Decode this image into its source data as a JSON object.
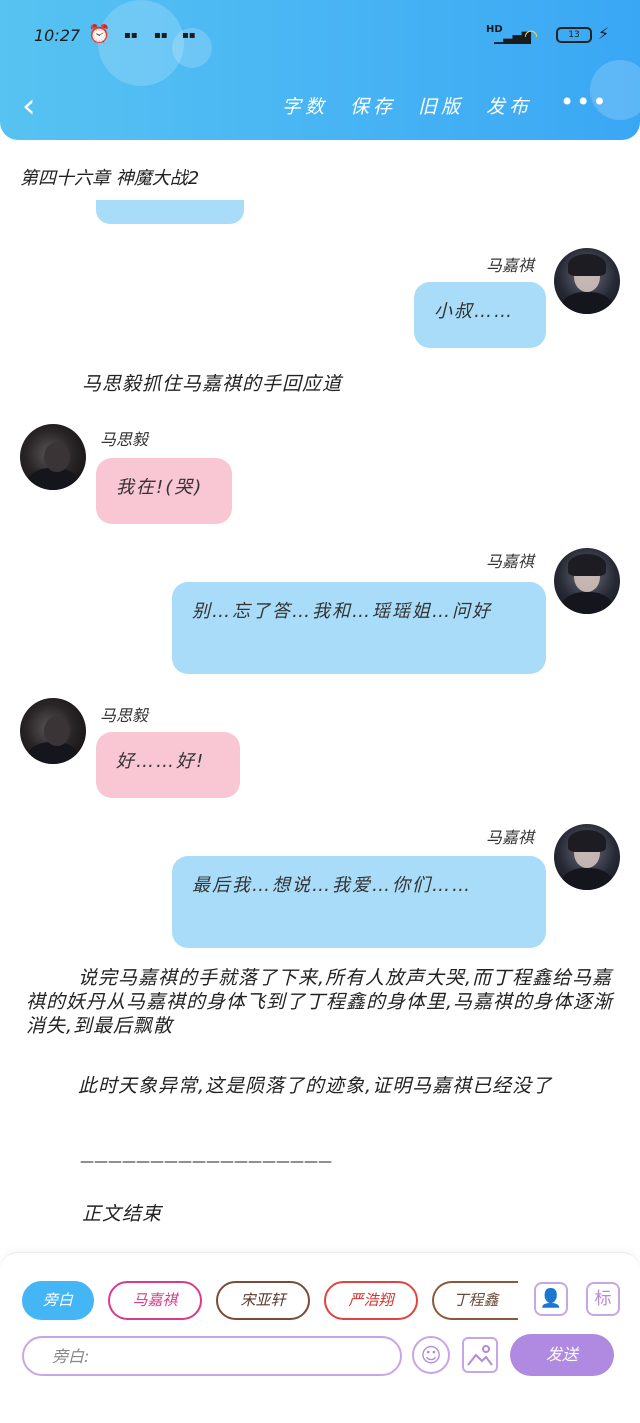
{
  "status_bar": {
    "time": "10:27",
    "network": "HD",
    "battery": "13"
  },
  "header": {
    "actions": [
      "字数",
      "保存",
      "旧版",
      "发布"
    ],
    "more": "•••"
  },
  "chapter_title": "第四十六章 神魔大战2",
  "messages": [
    {
      "side": "right",
      "name": "马嘉祺",
      "text": "小叔……"
    },
    {
      "side": "narration",
      "text": "马思毅抓住马嘉祺的手回应道"
    },
    {
      "side": "left",
      "name": "马思毅",
      "text": "我在!(哭)"
    },
    {
      "side": "right",
      "name": "马嘉祺",
      "text": "别…忘了答…我和…瑶瑶姐…问好"
    },
    {
      "side": "left",
      "name": "马思毅",
      "text": "好……好!"
    },
    {
      "side": "right",
      "name": "马嘉祺",
      "text": "最后我…想说…我爱…你们……"
    }
  ],
  "narration": {
    "p1": "说完马嘉祺的手就落了下来,所有人放声大哭,而丁程鑫给马嘉祺的妖丹从马嘉祺的身体飞到了丁程鑫的身体里,马嘉祺的身体逐渐消失,到最后飘散",
    "p2": "此时天象异常,这是陨落了的迹象,证明马嘉祺已经没了",
    "divider": "——————————————————",
    "ending": "正文结束"
  },
  "composer": {
    "roles": [
      "旁白",
      "马嘉祺",
      "宋亚轩",
      "严浩翔",
      "丁程鑫"
    ],
    "tool_labels": {
      "mark": "标"
    },
    "input_placeholder": "旁白:",
    "send_label": "发送"
  },
  "colors": {
    "header": "#3aa7f5",
    "bubble_right": "#a9dcf8",
    "bubble_left": "#f9c6d3",
    "role_active": "#44b6f5",
    "send": "#b08ae0",
    "role_borders": [
      "#44b6f5",
      "#d63c8a",
      "#7a4a3a",
      "#e0453d",
      "#8a5a3a"
    ]
  }
}
